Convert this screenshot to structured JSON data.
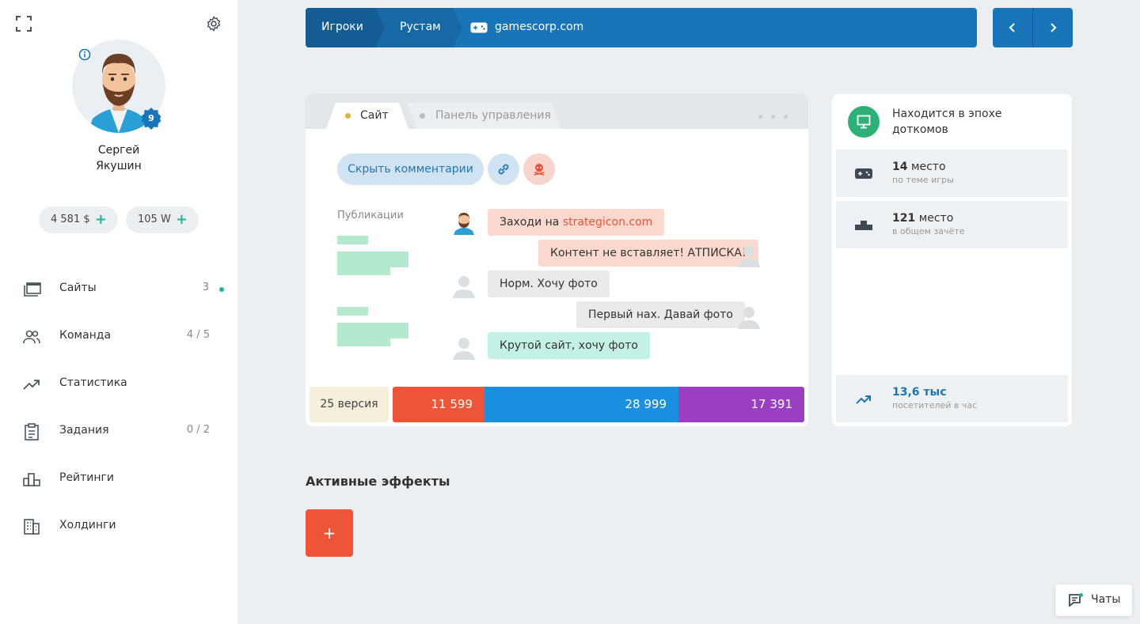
{
  "user": {
    "first_name": "Сергей",
    "last_name": "Якушин",
    "level": "9",
    "money": "4 581 $",
    "power": "105 W"
  },
  "nav": {
    "items": [
      {
        "label": "Сайты",
        "count": "3",
        "icon": "sites-icon"
      },
      {
        "label": "Команда",
        "count": "4 / 5",
        "icon": "team-icon"
      },
      {
        "label": "Статистика",
        "count": "",
        "icon": "stats-icon"
      },
      {
        "label": "Задания",
        "count": "0 / 2",
        "icon": "tasks-icon"
      },
      {
        "label": "Рейтинги",
        "count": "",
        "icon": "ratings-icon"
      },
      {
        "label": "Холдинги",
        "count": "",
        "icon": "holdings-icon"
      }
    ]
  },
  "breadcrumb": {
    "items": [
      "Игроки",
      "Рустам",
      "gamescorp.com"
    ]
  },
  "site_card": {
    "tabs": [
      {
        "label": "Сайт",
        "active": true,
        "dot_color": "#d9b441"
      },
      {
        "label": "Панель управления",
        "active": false,
        "dot_color": "#b8bec3"
      }
    ],
    "hide_comments_label": "Скрыть комментарии",
    "publications_label": "Публикации",
    "comments": [
      {
        "text_before": "Заходи на ",
        "link": "strategicon.com",
        "style": "salmon",
        "side": "left"
      },
      {
        "text": "Контент не вставляет! АТПИСКА!",
        "style": "salmon",
        "side": "right"
      },
      {
        "text": "Норм. Хочу фото",
        "style": "gray",
        "side": "left"
      },
      {
        "text": "Первый нах. Давай фото",
        "style": "gray",
        "side": "right"
      },
      {
        "text": "Крутой сайт, хочу фото",
        "style": "mint",
        "side": "left"
      }
    ],
    "version": "25 версия",
    "stats": [
      {
        "value": "11 599",
        "color": "#ee5538"
      },
      {
        "value": "28 999",
        "color": "#1b8fe0"
      },
      {
        "value": "17 391",
        "color": "#9b3fc2"
      }
    ]
  },
  "side_panel": {
    "epoch_line1": "Находится в эпохе",
    "epoch_line2": "доткомов",
    "rank_topic": {
      "place": "14",
      "word": "место",
      "sub": "по теме игры"
    },
    "rank_total": {
      "place": "121",
      "word": "место",
      "sub": "в общем зачёте"
    },
    "visitors": {
      "value": "13,6 тыс",
      "sub": "посетителей в час"
    }
  },
  "effects": {
    "title": "Активные эффекты",
    "add_label": "+"
  },
  "chat": {
    "label": "Чаты"
  }
}
